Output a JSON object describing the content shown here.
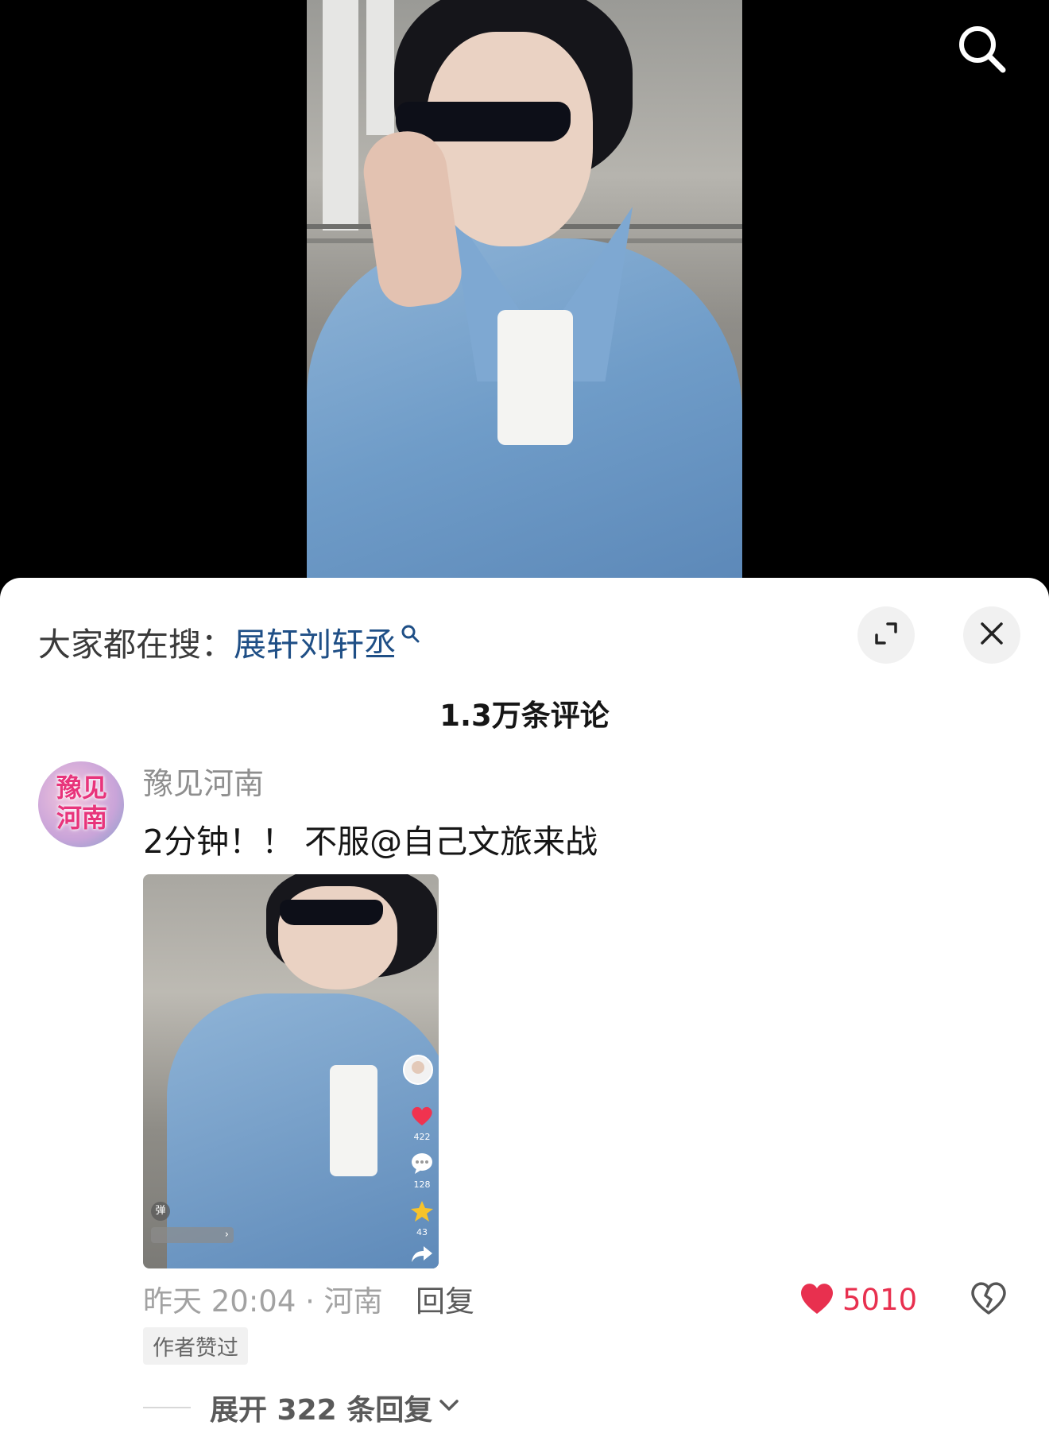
{
  "video": {
    "icons": {
      "search": "search-icon"
    }
  },
  "search_suggestion": {
    "prefix": "大家都在搜：",
    "term": "展轩刘轩丞",
    "icon": "search-icon"
  },
  "sheet_controls": {
    "expand_icon": "expand-icon",
    "close_icon": "close-icon"
  },
  "comments_header": {
    "count_label": "1.3万条评论"
  },
  "comment": {
    "avatar_text": "豫见河南",
    "author": "豫见河南",
    "text": "2分钟！！ 不服@自己文旅来战",
    "attachment": {
      "likes": "422",
      "comments": "128",
      "favorites": "43",
      "danmu_label": "弹",
      "bar_arrow": "›"
    },
    "meta": "昨天 20:04 · 河南",
    "reply_label": "回复",
    "like_count": "5010",
    "author_liked_tag": "作者赞过",
    "expand_replies_label": "展开 322 条回复"
  },
  "colors": {
    "accent_blue": "#1f4f86",
    "like_red": "#e8304f"
  }
}
